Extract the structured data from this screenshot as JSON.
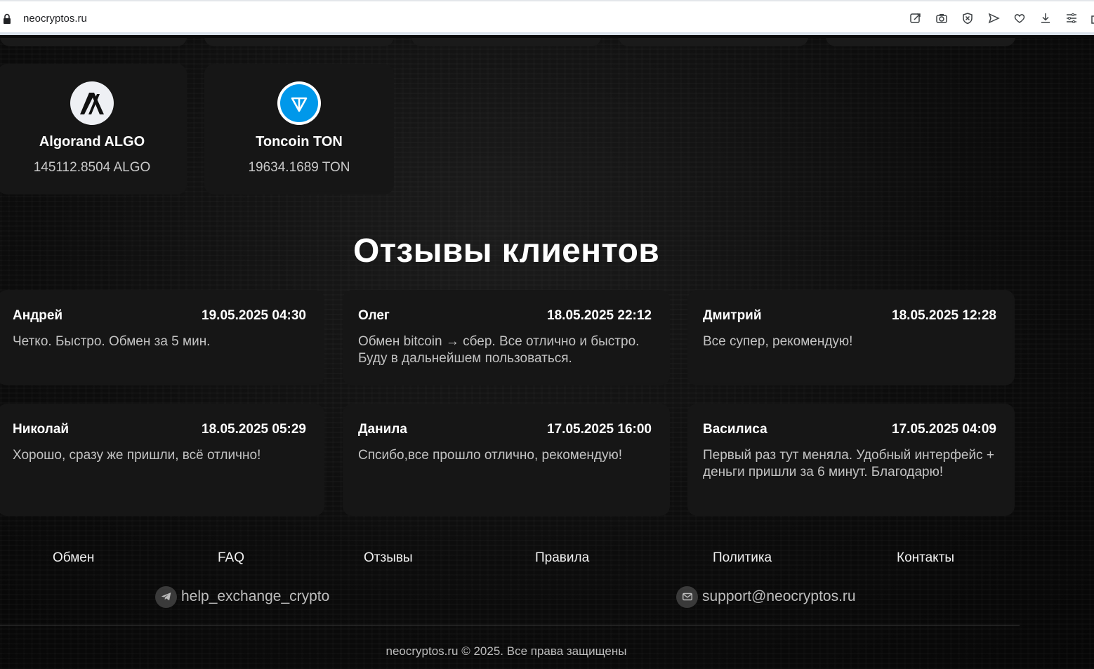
{
  "browser": {
    "url": "neocryptos.ru"
  },
  "coins": [
    {
      "name": "Algorand ALGO",
      "amount": "145112.8504 ALGO",
      "icon": "algorand-icon"
    },
    {
      "name": "Toncoin TON",
      "amount": "19634.1689 TON",
      "icon": "toncoin-icon",
      "color": "#0098ea"
    }
  ],
  "reviews": {
    "title": "Отзывы клиентов",
    "items": [
      {
        "name": "Андрей",
        "date": "19.05.2025 04:30",
        "text": "Четко. Быстро. Обмен за 5 мин."
      },
      {
        "name": "Олег",
        "date": "18.05.2025 22:12",
        "text": "Обмен bitcoin → сбер. Все отлично и быстро. Буду в дальнейшем пользоваться."
      },
      {
        "name": "Дмитрий",
        "date": "18.05.2025 12:28",
        "text": "Все супер, рекомендую!"
      },
      {
        "name": "Николай",
        "date": "18.05.2025 05:29",
        "text": "Хорошо, сразу же пришли, всё отлично!"
      },
      {
        "name": "Данила",
        "date": "17.05.2025 16:00",
        "text": "Спсибо,все прошло отлично, рекомендую!"
      },
      {
        "name": "Василиса",
        "date": "17.05.2025 04:09",
        "text": "Первый раз тут меняла. Удобный интерфейс + деньги пришли за 6 минут. Благодарю!"
      }
    ]
  },
  "footer": {
    "nav": [
      "Обмен",
      "FAQ",
      "Отзывы",
      "Правила",
      "Политика",
      "Контакты"
    ],
    "telegram": "help_exchange_crypto",
    "email": "support@neocryptos.ru",
    "copyright": "neocryptos.ru © 2025. Все права защищены"
  }
}
